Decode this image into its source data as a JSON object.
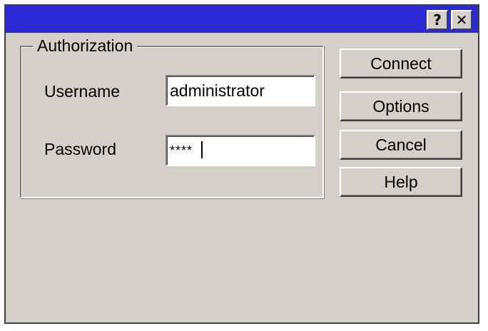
{
  "titlebar": {
    "help_glyph": "?",
    "close_glyph": "✕",
    "color": "#2a2ad4"
  },
  "authorization": {
    "legend": "Authorization",
    "username_label": "Username",
    "username_value": "administrator",
    "password_label": "Password",
    "password_value": "****"
  },
  "buttons": {
    "connect": "Connect",
    "options": "Options",
    "cancel": "Cancel",
    "help": "Help"
  },
  "colors": {
    "dialog_face": "#d4d0c8",
    "input_background": "#ffffff"
  }
}
